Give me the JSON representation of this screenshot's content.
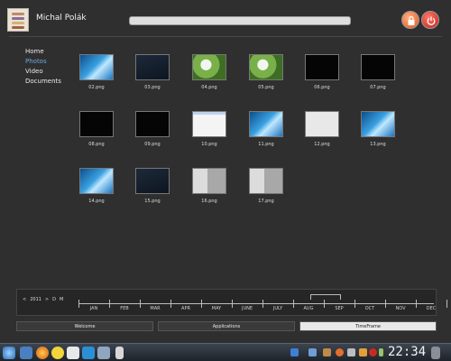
{
  "header": {
    "username": "Michal Polák",
    "search_value": ""
  },
  "sidebar": {
    "items": [
      {
        "label": "Home",
        "active": false
      },
      {
        "label": "Photos",
        "active": true
      },
      {
        "label": "Video",
        "active": false
      },
      {
        "label": "Documents",
        "active": false
      }
    ]
  },
  "photos": [
    {
      "file": "02.png",
      "style": "blue"
    },
    {
      "file": "03.png",
      "style": "dark"
    },
    {
      "file": "04.png",
      "style": "green"
    },
    {
      "file": "05.png",
      "style": "green"
    },
    {
      "file": "06.png",
      "style": "black"
    },
    {
      "file": "07.png",
      "style": "black"
    },
    {
      "file": "08.png",
      "style": "black"
    },
    {
      "file": "09.png",
      "style": "black"
    },
    {
      "file": "10.png",
      "style": "white"
    },
    {
      "file": "11.png",
      "style": "blue"
    },
    {
      "file": "12.png",
      "style": "light"
    },
    {
      "file": "13.png",
      "style": "blue"
    },
    {
      "file": "14.png",
      "style": "blue"
    },
    {
      "file": "15.png",
      "style": "dark"
    },
    {
      "file": "16.png",
      "style": "gray"
    },
    {
      "file": "17.png",
      "style": "gray"
    }
  ],
  "timeline": {
    "prev": "<",
    "year": "2011",
    "next": ">",
    "view_d": "D",
    "view_m": "M",
    "months": [
      "JAN",
      "FEB",
      "MAR",
      "APR",
      "MAY",
      "JUNE",
      "JULY",
      "AUG",
      "SEP",
      "OCT",
      "NOV",
      "DEC"
    ],
    "selected_month": "SEP"
  },
  "tabs": [
    {
      "label": "Welcome",
      "active": false
    },
    {
      "label": "Applications",
      "active": false
    },
    {
      "label": "TimeFrame",
      "active": true
    }
  ],
  "taskbar": {
    "clock": "22:34",
    "icons": [
      "kde-menu-icon",
      "file-manager-icon",
      "firefox-icon",
      "chat-icon",
      "mail-icon",
      "media-player-icon",
      "tool-icon",
      "document-icon"
    ],
    "tray": [
      "folder-icon",
      "clipboard-icon",
      "package-icon",
      "update-icon",
      "network-icon",
      "volume-icon",
      "power-icon",
      "battery-icon"
    ]
  },
  "colors": {
    "accent": "#6fa8e0",
    "background": "#2f2f2f"
  }
}
